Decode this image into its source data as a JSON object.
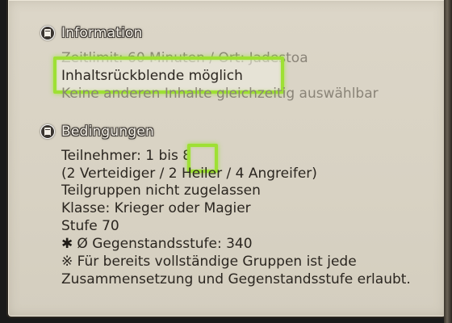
{
  "information": {
    "title": "Information",
    "lines": [
      "Zeitlimit: 60 Minuten / Ort: Jadestoa",
      "Inhaltsrückblende möglich",
      "Keine anderen Inhalte gleichzeitig auswählbar"
    ]
  },
  "conditions": {
    "title": "Bedingungen",
    "participants_prefix": "Teilnehmer: 1 bis ",
    "participants_max": "8",
    "lines": [
      "(2 Verteidiger / 2 Heiler / 4 Angreifer)",
      "Teilgruppen nicht zugelassen",
      "Klasse: Krieger oder Magier",
      "Stufe 70"
    ],
    "item_level_symbol": "✱",
    "item_level": "Ø Gegenstandsstufe: 340",
    "note_line1": "※ Für bereits vollständige Gruppen ist jede",
    "note_line2": "Zusammensetzung und Gegenstandsstufe erlaubt."
  },
  "colors": {
    "highlight": "#9ee034",
    "text": "#2b2620",
    "panel": "#d8d2c3"
  }
}
